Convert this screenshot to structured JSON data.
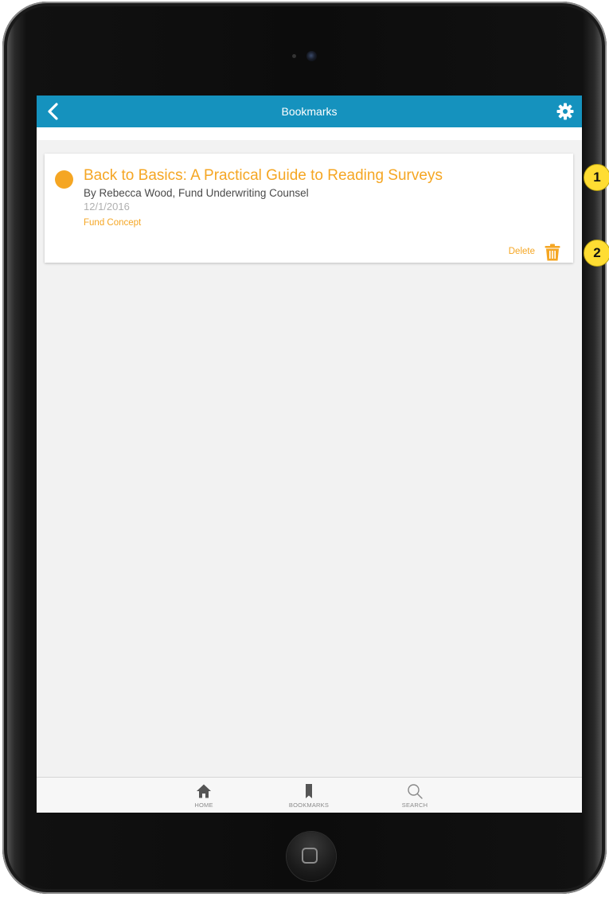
{
  "header": {
    "title": "Bookmarks",
    "back_icon": "chevron-left-icon",
    "settings_icon": "gear-icon"
  },
  "bookmarks": [
    {
      "title": "Back to Basics: A Practical Guide to Reading Surveys",
      "author": "By Rebecca Wood, Fund Underwriting Counsel",
      "date": "12/1/2016",
      "category": "Fund Concept",
      "delete_label": "Delete"
    }
  ],
  "tabs": [
    {
      "label": "HOME",
      "icon": "home-icon"
    },
    {
      "label": "BOOKMARKS",
      "icon": "bookmark-icon"
    },
    {
      "label": "SEARCH",
      "icon": "search-icon"
    }
  ],
  "callouts": [
    "1",
    "2"
  ],
  "colors": {
    "nav_bar": "#1592be",
    "accent": "#f5a623",
    "callout": "#ffdd33"
  }
}
